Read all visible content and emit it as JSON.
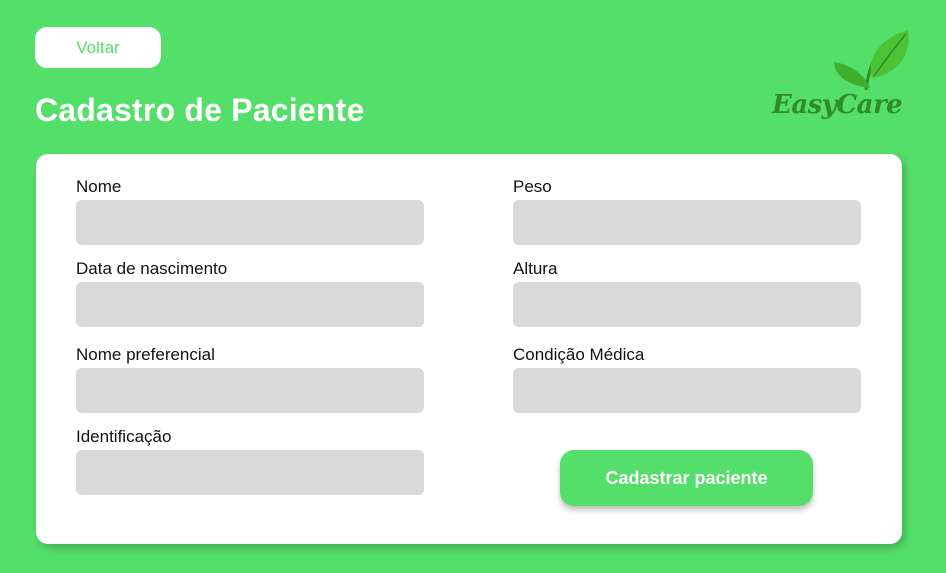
{
  "header": {
    "back_label": "Voltar",
    "title": "Cadastro de Paciente"
  },
  "logo": {
    "text": "EasyCare",
    "icon": "leaf-icon"
  },
  "form": {
    "left_fields": [
      {
        "label": "Nome",
        "value": ""
      },
      {
        "label": "Data de nascimento",
        "value": ""
      },
      {
        "label": "Nome preferencial",
        "value": ""
      },
      {
        "label": "Identificação",
        "value": ""
      }
    ],
    "right_fields": [
      {
        "label": "Peso",
        "value": ""
      },
      {
        "label": "Altura",
        "value": ""
      },
      {
        "label": "Condição Médica",
        "value": ""
      }
    ],
    "submit_label": "Cadastrar paciente"
  },
  "colors": {
    "background": "#53df6a",
    "card": "#ffffff",
    "input": "#d9d9d9",
    "logo_text": "#2f8b2b"
  }
}
